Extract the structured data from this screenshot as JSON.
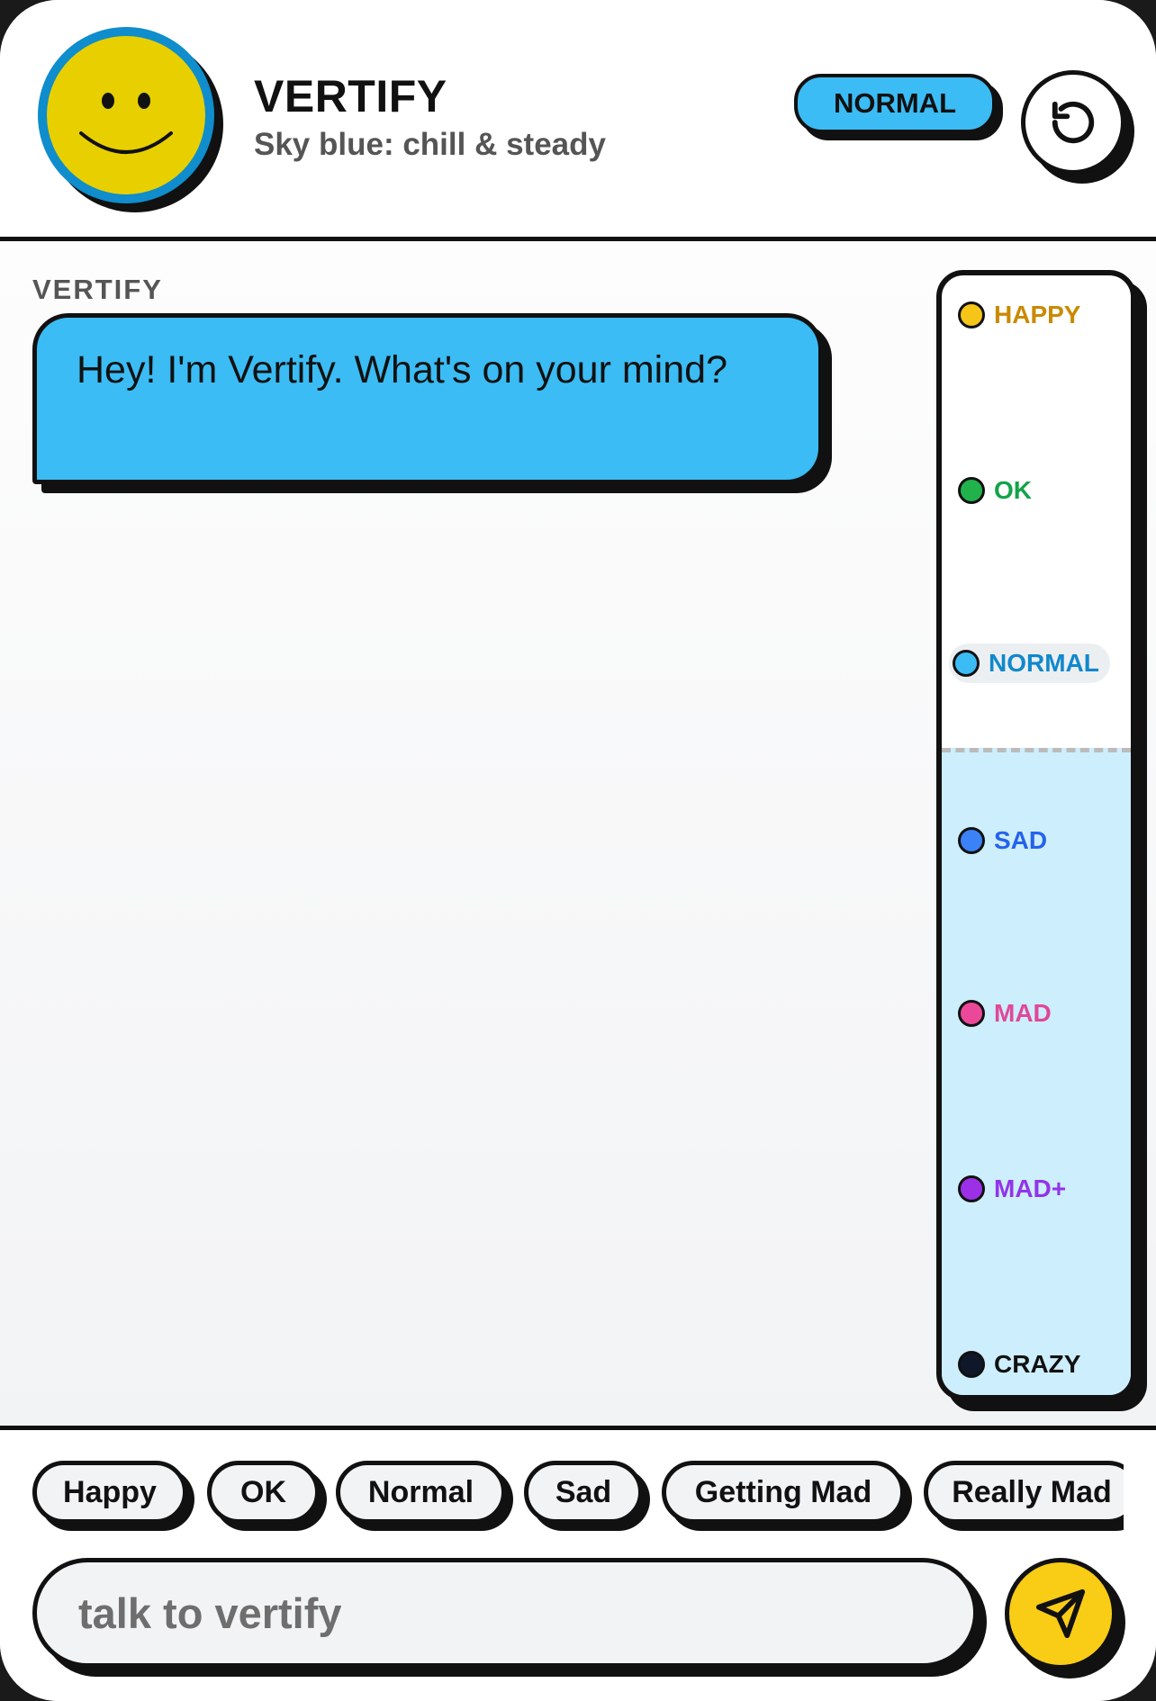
{
  "header": {
    "title": "VERTIFY",
    "subtitle": "Sky blue: chill & steady",
    "mood_badge": "NORMAL",
    "avatar_icon": "smiley-face-icon",
    "reset_icon": "rotate-ccw-icon"
  },
  "chat": {
    "messages": [
      {
        "sender": "VERTIFY",
        "text": "Hey! I'm Vertify. What's on your mind?"
      }
    ]
  },
  "mood_meter": {
    "current": "NORMAL",
    "levels": [
      {
        "label": "HAPPY",
        "color": "#f5c518",
        "text_color": "#c98a00"
      },
      {
        "label": "OK",
        "color": "#22b24c",
        "text_color": "#14a34a"
      },
      {
        "label": "NORMAL",
        "color": "#3bbcf4",
        "text_color": "#1188cc"
      },
      {
        "label": "SAD",
        "color": "#3b82f6",
        "text_color": "#2563eb"
      },
      {
        "label": "MAD",
        "color": "#ec4899",
        "text_color": "#e0479a"
      },
      {
        "label": "MAD+",
        "color": "#9b30e6",
        "text_color": "#9333ea"
      },
      {
        "label": "CRAZY",
        "color": "#0f172a",
        "text_color": "#111111"
      }
    ]
  },
  "quick_replies": [
    "Happy",
    "OK",
    "Normal",
    "Sad",
    "Getting Mad",
    "Really Mad"
  ],
  "composer": {
    "placeholder": "talk to vertify",
    "value": "",
    "send_icon": "send-icon"
  },
  "colors": {
    "accent": "#3bbcf4",
    "send": "#f9cc16",
    "avatar": "#e8d000",
    "outline": "#111111"
  }
}
